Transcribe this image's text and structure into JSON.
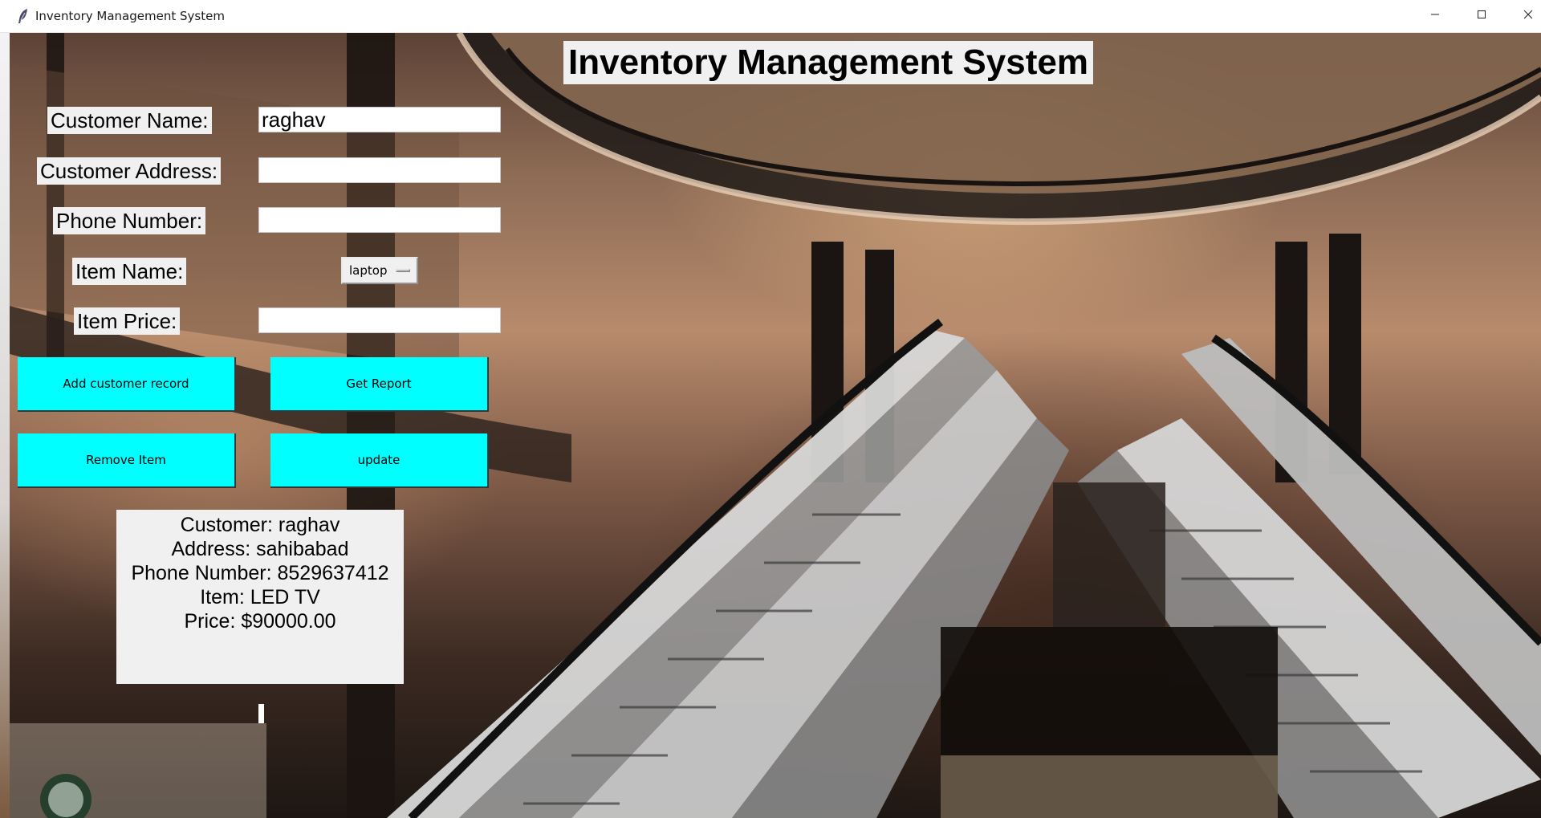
{
  "window": {
    "title": "Inventory Management System"
  },
  "heading": "Inventory Management System",
  "form": {
    "customer_name_label": "Customer Name:",
    "customer_name_value": "raghav",
    "customer_address_label": "Customer Address:",
    "customer_address_value": "",
    "phone_number_label": "Phone Number:",
    "phone_number_value": "",
    "item_name_label": "Item Name:",
    "item_name_selected": "laptop",
    "item_price_label": "Item Price:",
    "item_price_value": ""
  },
  "buttons": {
    "add_customer_record": "Add customer record",
    "get_report": "Get Report",
    "remove_item": "Remove Item",
    "update": "update"
  },
  "report": {
    "customer": "Customer: raghav",
    "address": "Address: sahibabad",
    "phone": "Phone Number: 8529637412",
    "item": "Item: LED TV",
    "price": "Price: $90000.00"
  },
  "colors": {
    "button_bg": "#00ffff",
    "label_bg": "#f0f0f0"
  },
  "icons": {
    "app": "feather-icon",
    "minimize": "minimize-icon",
    "maximize": "maximize-icon",
    "close": "close-icon"
  }
}
